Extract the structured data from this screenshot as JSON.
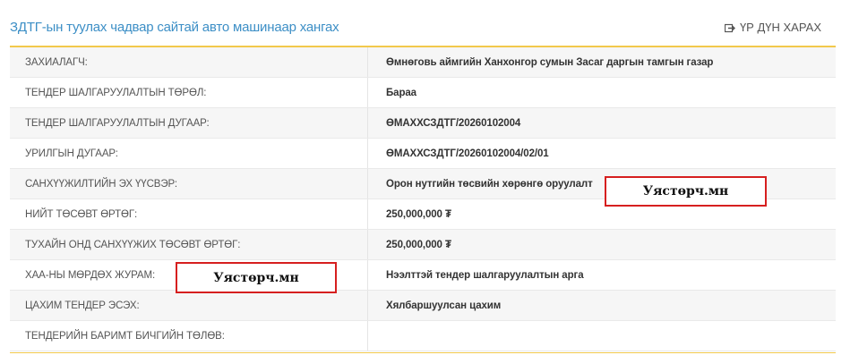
{
  "header": {
    "title": "ЗДТГ-ын туулах чадвар сайтай авто машинаар хангах",
    "result_link": "ҮР ДҮН ХАРАХ"
  },
  "rows": [
    {
      "label": "ЗАХИАЛАГЧ:",
      "value": "Өмнөговь аймгийн Ханхонгор сумын Засаг даргын тамгын газар"
    },
    {
      "label": "ТЕНДЕР ШАЛГАРУУЛАЛТЫН ТӨРӨЛ:",
      "value": "Бараа"
    },
    {
      "label": "ТЕНДЕР ШАЛГАРУУЛАЛТЫН ДУГААР:",
      "value": "ӨМАХХСЗДТГ/20260102004"
    },
    {
      "label": "УРИЛГЫН ДУГААР:",
      "value": "ӨМАХХСЗДТГ/20260102004/02/01"
    },
    {
      "label": "САНХҮҮЖИЛТИЙН ЭХ ҮҮСВЭР:",
      "value": "Орон нутгийн төсвийн хөрөнгө оруулалт"
    },
    {
      "label": "НИЙТ ТӨСӨВТ ӨРТӨГ:",
      "value": "250,000,000 ₮"
    },
    {
      "label": "ТУХАЙН ОНД САНХҮҮЖИХ ТӨСӨВТ ӨРТӨГ:",
      "value": "250,000,000 ₮"
    },
    {
      "label": "ХАА-НЫ МӨРДӨХ ЖУРАМ:",
      "value": "Нээлттэй тендер шалгаруулалтын арга"
    },
    {
      "label": "ЦАХИМ ТЕНДЕР ЭСЭХ:",
      "value": "Хялбаршуулсан цахим"
    },
    {
      "label": "ТЕНДЕРИЙН БАРИМТ БИЧГИЙН ТӨЛӨВ:",
      "value": ""
    }
  ],
  "watermarks": [
    "Уястөрч.мн",
    "Уястөрч.мн"
  ],
  "colors": {
    "accent": "#f2c94c",
    "title": "#3d8fc6",
    "watermark_border": "#d61f1f"
  },
  "icons": {
    "result_link": "external-link-icon"
  }
}
